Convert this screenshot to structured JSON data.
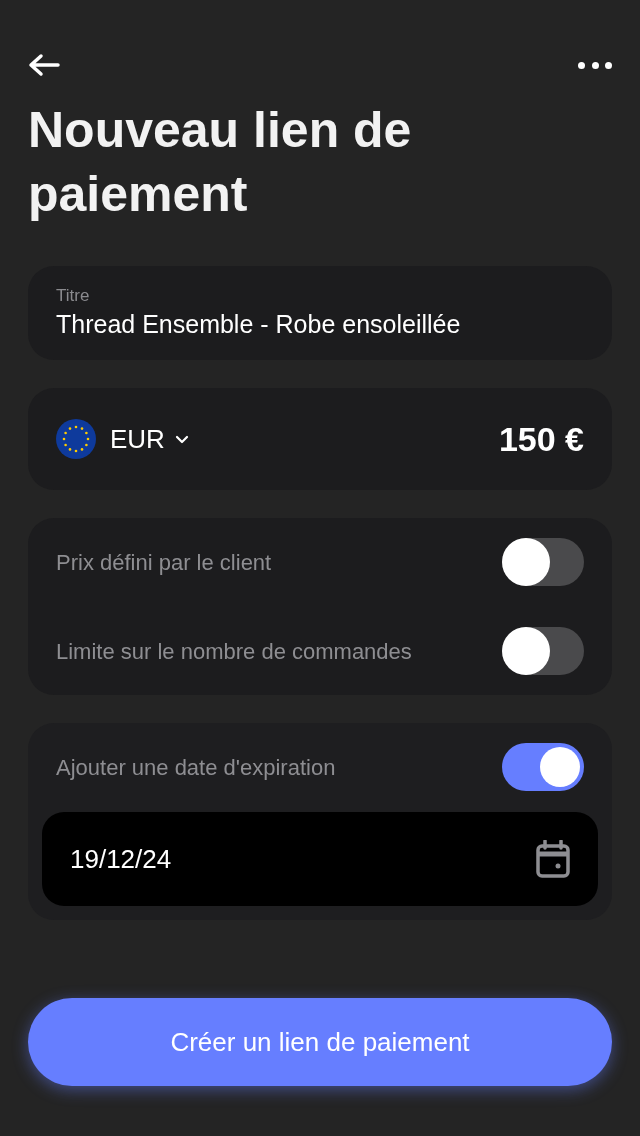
{
  "header": {
    "title": "Nouveau lien de paiement"
  },
  "title_field": {
    "label": "Titre",
    "value": "Thread Ensemble - Robe ensoleillée"
  },
  "amount": {
    "currency": "EUR",
    "value": "150 €"
  },
  "options": [
    {
      "label": "Prix défini par le client",
      "on": false
    },
    {
      "label": "Limite sur le nombre de commandes",
      "on": false
    }
  ],
  "expiration": {
    "label": "Ajouter une date d'expiration",
    "on": true,
    "date": "19/12/24"
  },
  "submit": {
    "label": "Créer un lien de paiement"
  }
}
